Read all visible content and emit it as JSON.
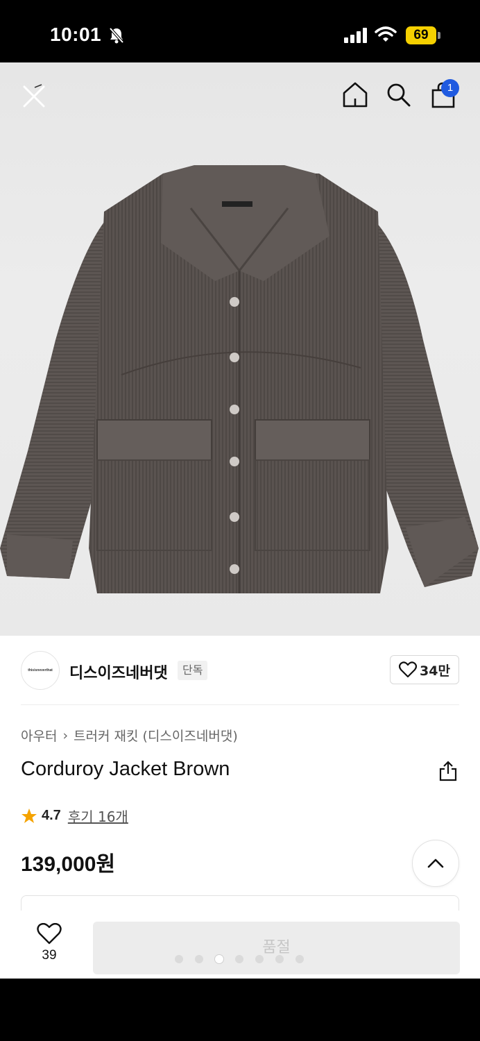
{
  "status_bar": {
    "time": "10:01",
    "battery": "69"
  },
  "header": {
    "cart_badge": "1"
  },
  "brand": {
    "logo_text": "thisisneverthat",
    "name": "디스이즈네버댓",
    "badge": "단독",
    "like_count": "34만"
  },
  "breadcrumb": {
    "category": "아우터",
    "separator": "›",
    "subcategory": "트러커 재킷 (디스이즈네버댓)"
  },
  "product": {
    "title": "Corduroy Jacket Brown",
    "rating": "4.7",
    "reviews": "후기 16개",
    "price": "139,000원"
  },
  "bottom_bar": {
    "wish_count": "39",
    "buy_label": "품절"
  },
  "carousel": {
    "total": 7,
    "active_index": 2
  },
  "colors": {
    "accent": "#1f5ae0",
    "star": "#f5a300",
    "jacket": "#5b5450"
  }
}
